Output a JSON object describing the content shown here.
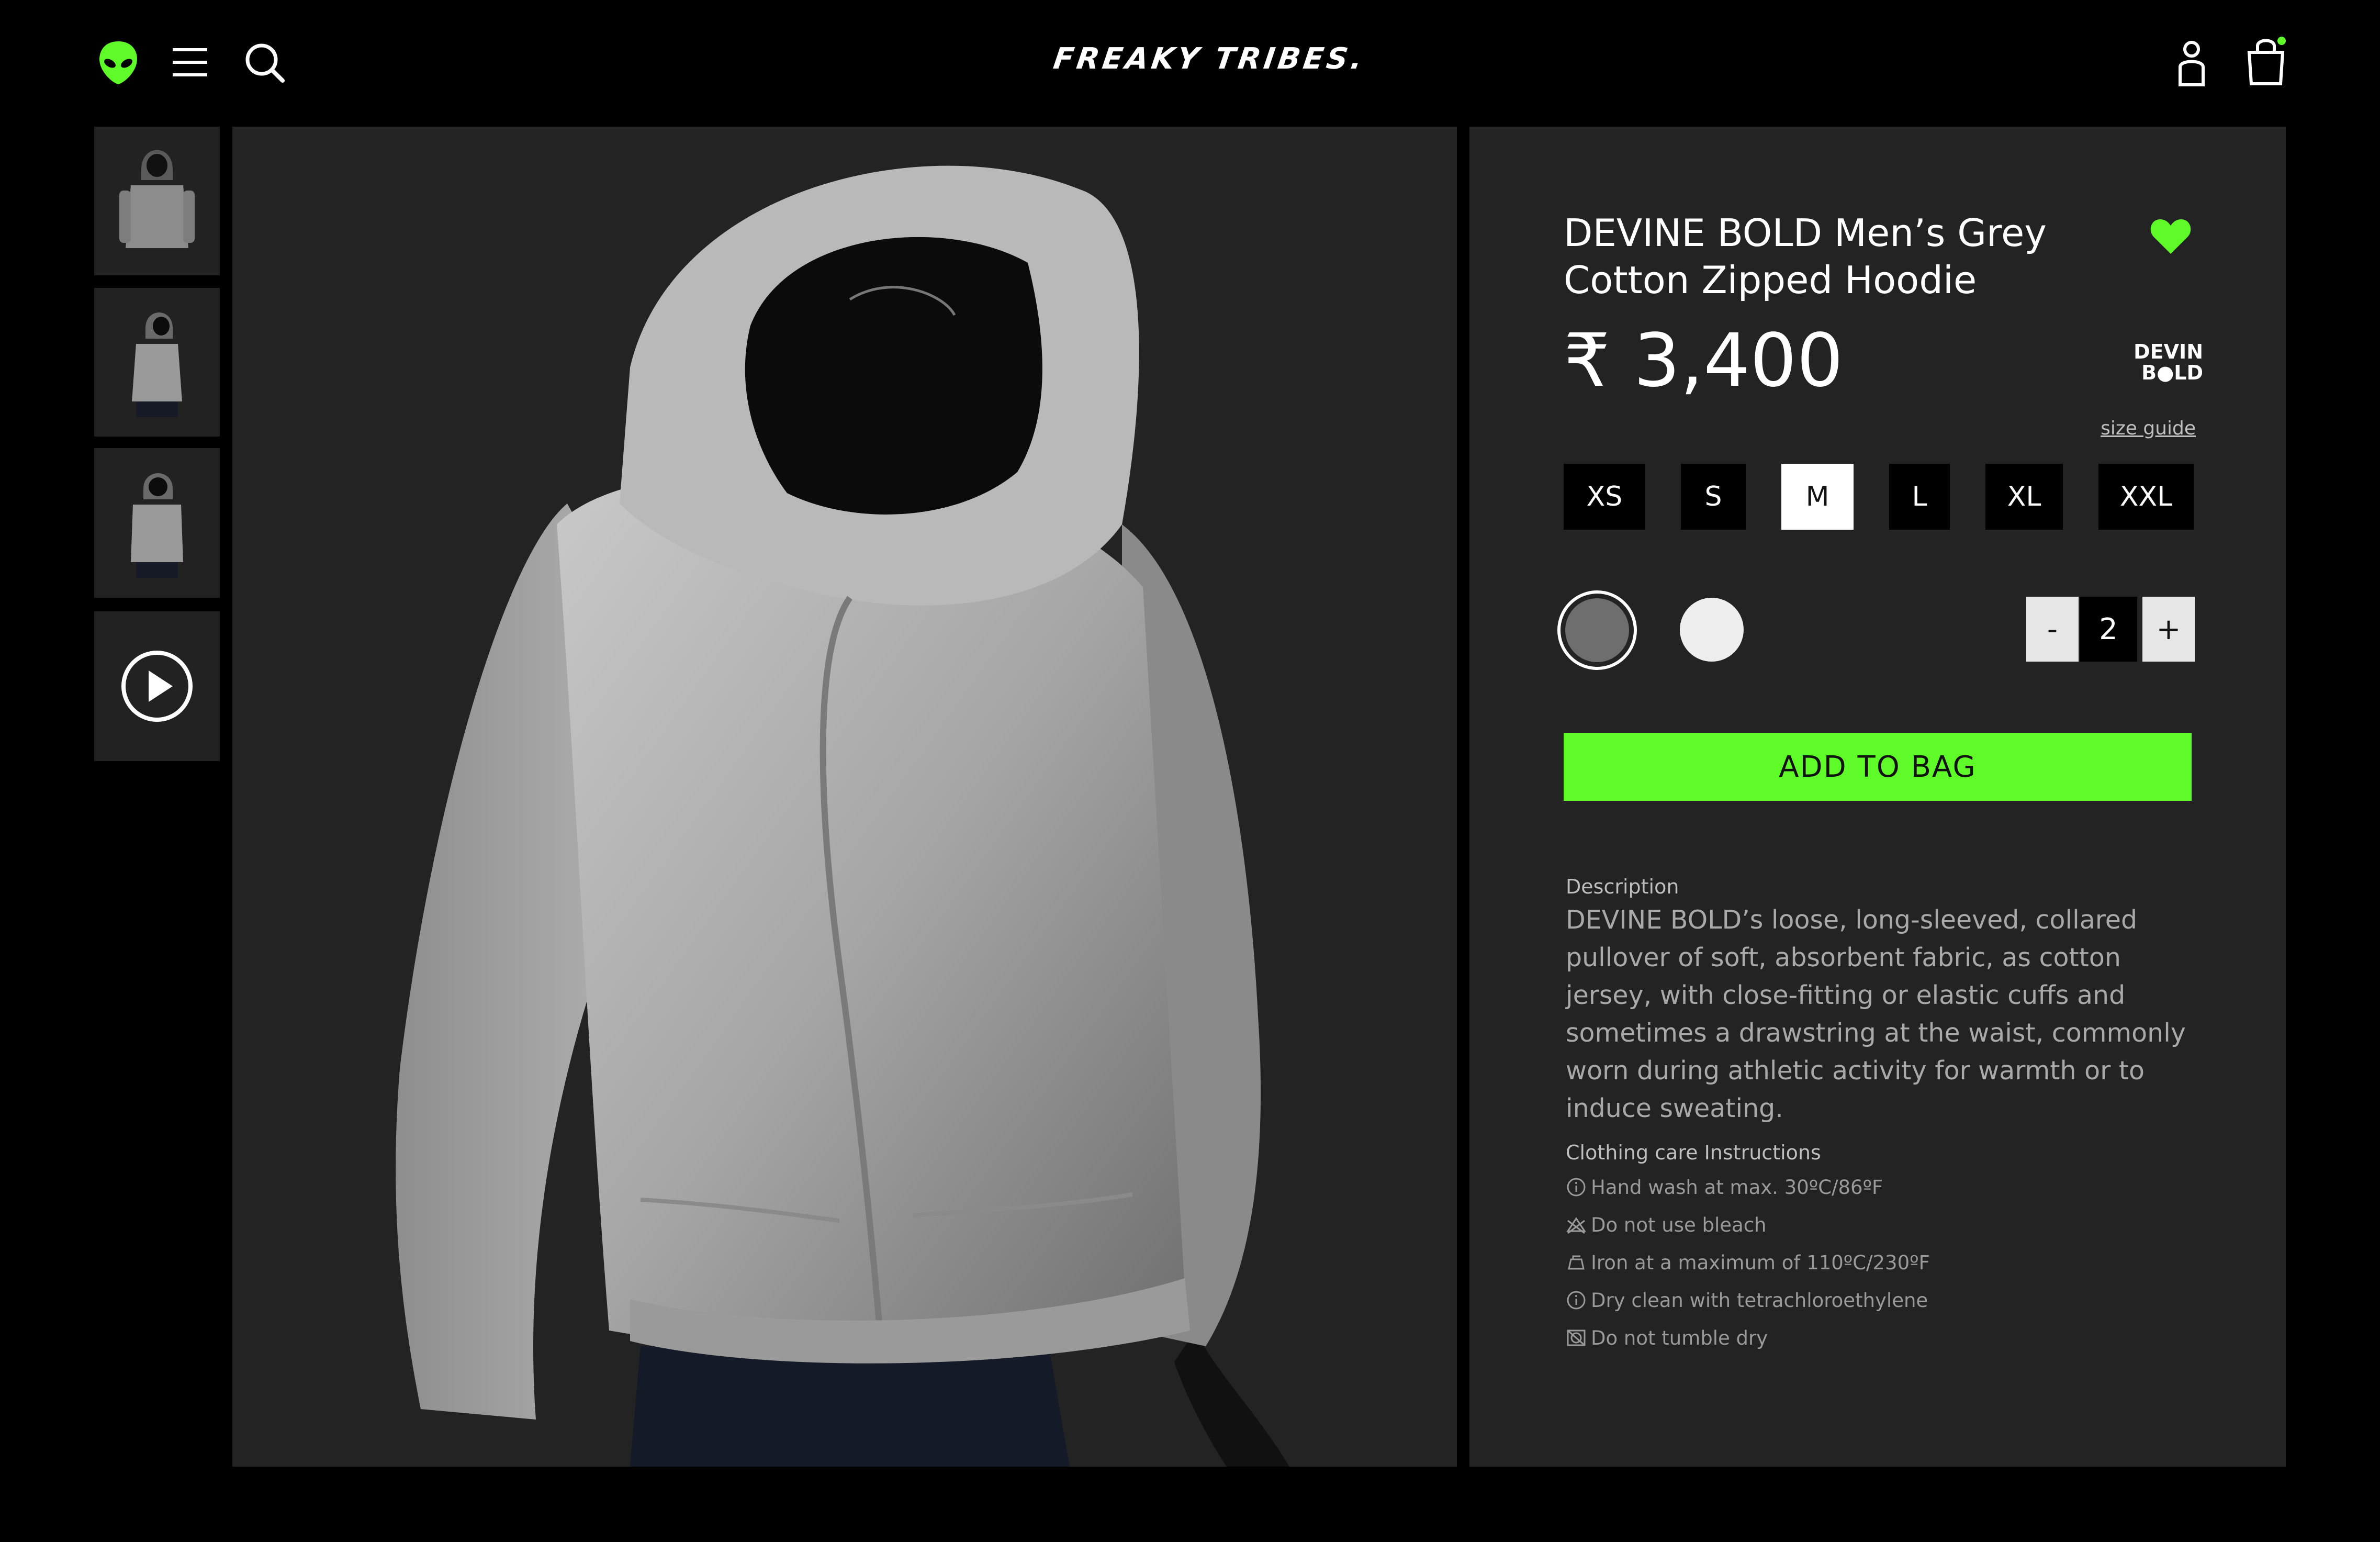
{
  "header": {
    "brand": "FREAKY TRIBES.",
    "icons": [
      "alien-logo-icon",
      "menu-icon",
      "search-icon",
      "user-icon",
      "shopping-bag-icon"
    ]
  },
  "thumbnails": [
    "hoodie-front",
    "hoodie-side",
    "hoodie-angle",
    "play-video"
  ],
  "product": {
    "title_line1": "DEVINE BOLD Men’s Grey",
    "title_line2": "Cotton Zipped Hoodie",
    "price": "₹ 3,400",
    "brand_mark_line1": "DEVIN",
    "brand_mark_line2": "B●LD",
    "size_guide": "size guide",
    "sizes": [
      "XS",
      "S",
      "M",
      "L",
      "XL",
      "XXL"
    ],
    "selected_size": "M",
    "colors": [
      "#6e6e6e",
      "#eeeeee"
    ],
    "quantity": {
      "minus": "-",
      "value": "2",
      "plus": "+"
    },
    "add_to_bag": "ADD TO BAG",
    "description_label": "Description",
    "description": "DEVINE BOLD’s loose, long-sleeved, collared pullover of soft, absorbent fabric, as cotton jersey, with close-fitting or elastic cuffs and sometimes a drawstring at the waist, commonly worn during athletic activity for warmth or to induce sweating.",
    "care_label": "Clothing care Instructions",
    "care": [
      "Hand wash at max. 30ºC/86ºF",
      "Do not use bleach",
      "Iron at a maximum of 110ºC/230ºF",
      "Dry clean with tetrachloroethylene",
      "Do not tumble dry"
    ]
  },
  "colors": {
    "accent": "#5ffb28",
    "background": "#000000",
    "panel": "#232323"
  }
}
